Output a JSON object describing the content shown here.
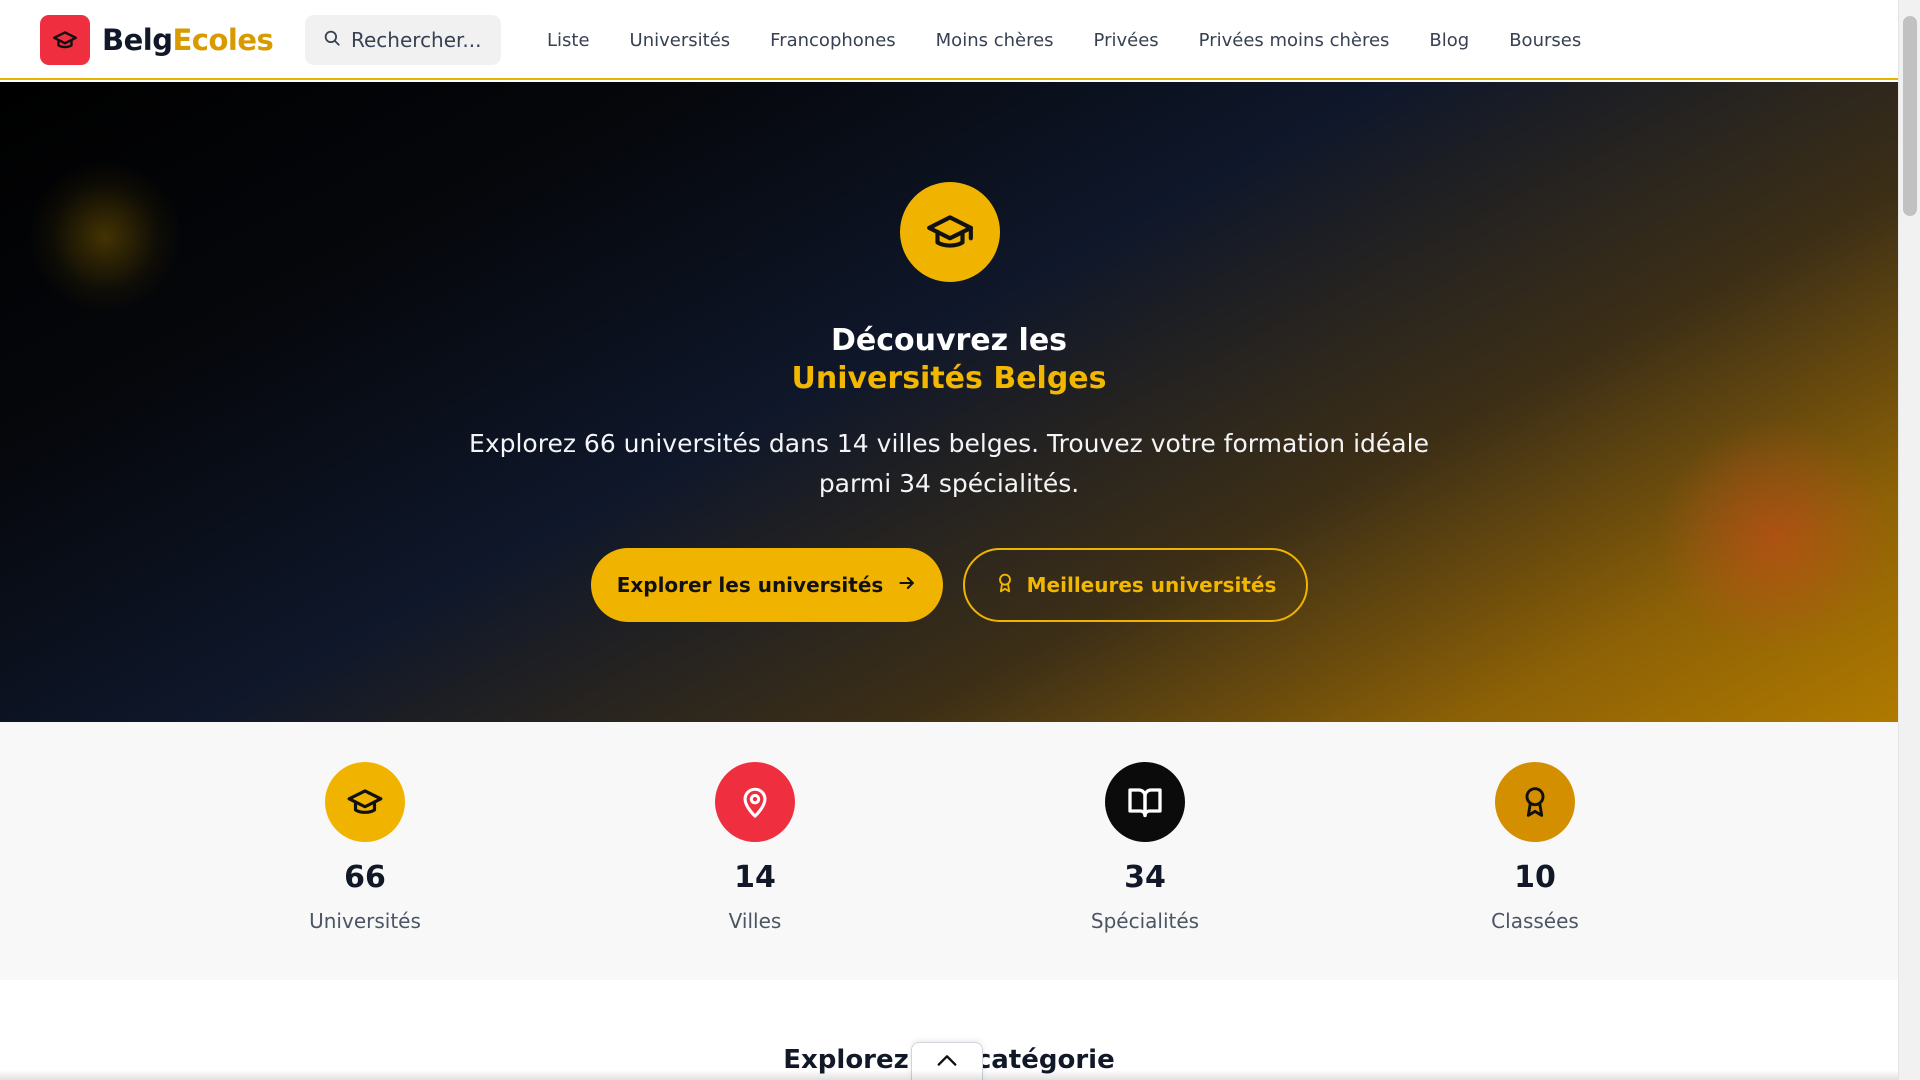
{
  "header": {
    "logo": {
      "part1": "Belg",
      "part2": "Ecoles",
      "icon": "graduation-cap-icon"
    },
    "search": {
      "placeholder": "Rechercher...",
      "icon": "search-icon"
    },
    "nav": [
      "Liste",
      "Universités",
      "Francophones",
      "Moins chères",
      "Privées",
      "Privées moins chères",
      "Blog",
      "Bourses"
    ]
  },
  "hero": {
    "icon": "graduation-cap-icon",
    "title_line1": "Découvrez les",
    "title_line2": "Universités Belges",
    "subtitle": "Explorez 66 universités dans 14 villes belges. Trouvez votre formation idéale parmi 34 spécialités.",
    "primary_button": {
      "label": "Explorer les universités",
      "icon": "arrow-right-icon"
    },
    "secondary_button": {
      "label": "Meilleures universités",
      "icon": "award-icon"
    }
  },
  "stats": [
    {
      "value": "66",
      "label": "Universités",
      "icon": "graduation-cap-icon",
      "color": "#f0b400"
    },
    {
      "value": "14",
      "label": "Villes",
      "icon": "map-pin-icon",
      "color": "#ef2f3f"
    },
    {
      "value": "34",
      "label": "Spécialités",
      "icon": "book-open-icon",
      "color": "#0b0b0b"
    },
    {
      "value": "10",
      "label": "Classées",
      "icon": "award-icon",
      "color": "#d48f00"
    }
  ],
  "next_section": {
    "title": "Explorez par catégorie"
  },
  "colors": {
    "accent": "#f0b400",
    "brand_red": "#ef2f3f",
    "dark": "#0b0b0b",
    "gold": "#d48f00"
  }
}
